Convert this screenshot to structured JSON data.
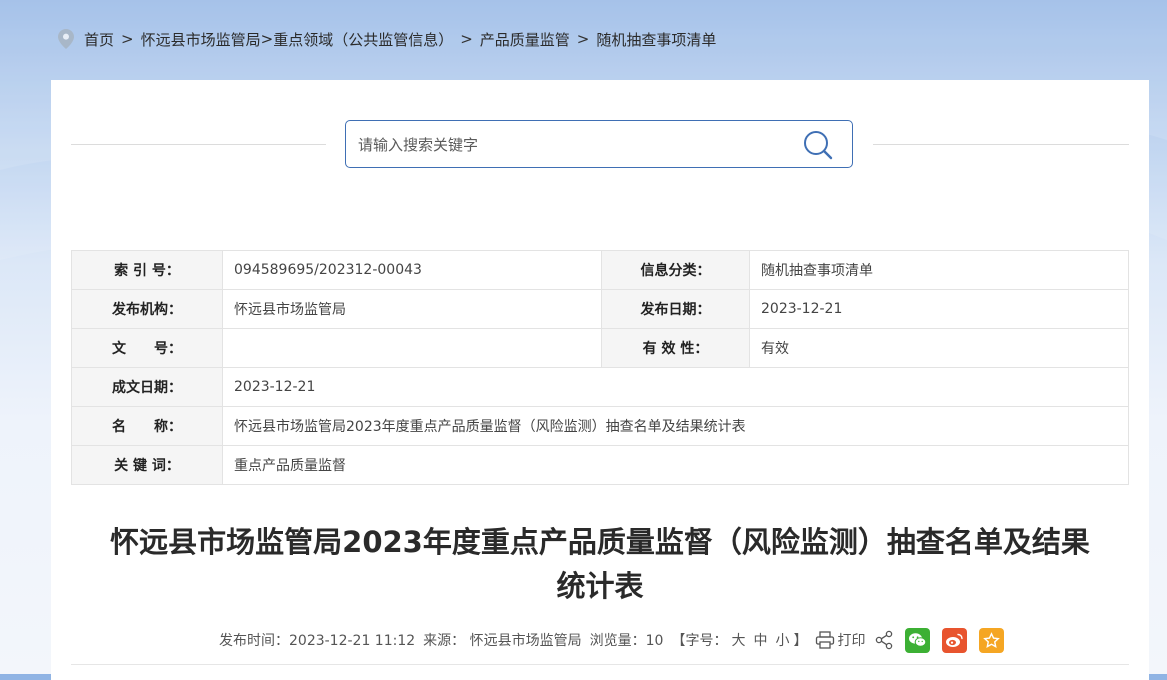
{
  "breadcrumb": {
    "items": [
      "首页",
      "怀远县市场监管局",
      "重点领域（公共监管信息）",
      "产品质量监管",
      "随机抽查事项清单"
    ]
  },
  "search": {
    "placeholder": "请输入搜索关键字"
  },
  "meta": {
    "index_label": "索 引 号：",
    "index_value": "094589695/202312-00043",
    "category_label": "信息分类：",
    "category_value": "随机抽查事项清单",
    "publisher_label": "发布机构：",
    "publisher_value": "怀远县市场监管局",
    "publish_date_label": "发布日期：",
    "publish_date_value": "2023-12-21",
    "doc_no_label": "文　　号：",
    "doc_no_value": "",
    "validity_label": "有 效 性：",
    "validity_value": "有效",
    "created_date_label": "成文日期：",
    "created_date_value": "2023-12-21",
    "name_label": "名　　称：",
    "name_value": "怀远县市场监管局2023年度重点产品质量监督（风险监测）抽查名单及结果统计表",
    "keywords_label": "关 键 词：",
    "keywords_value": "重点产品质量监督"
  },
  "article": {
    "title_line1": "怀远县市场监管局2023年度重点产品质量监督（风险监测）抽查名单及结果",
    "title_line2": "统计表",
    "publish_time": "发布时间：2023-12-21 11:12",
    "source": "来源： 怀远县市场监管局",
    "views": "浏览量：10",
    "font_size_prefix": "【字号：",
    "font_large": "大",
    "font_medium": "中",
    "font_small": "小",
    "font_size_suffix": "】",
    "print": "打印"
  },
  "colors": {
    "search_border": "#3f6fb4",
    "wechat": "#3cb034",
    "weibo": "#e8542e",
    "favorite": "#f5a623"
  },
  "icons": [
    "location-pin-icon",
    "search-icon",
    "printer-icon",
    "share-icon",
    "wechat-icon",
    "weibo-icon",
    "favorite-star-icon"
  ]
}
